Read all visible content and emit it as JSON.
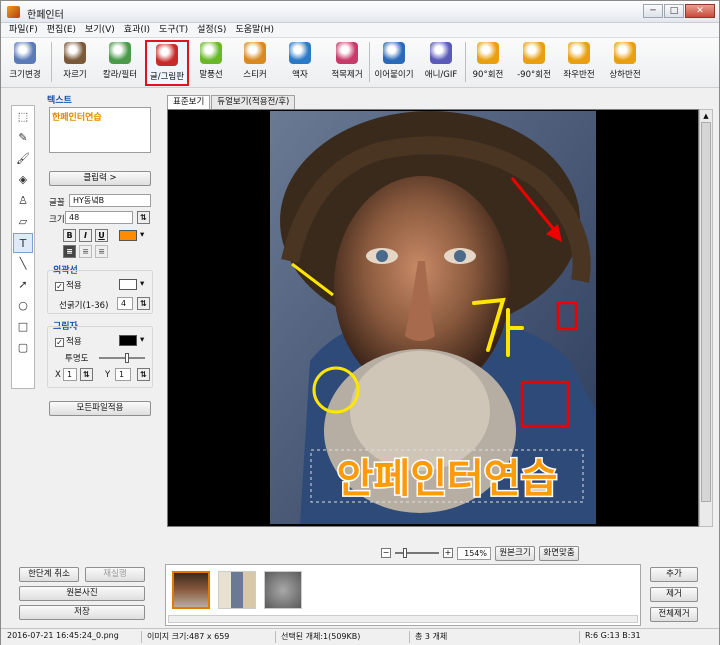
{
  "window": {
    "title": "한페인터",
    "min": "─",
    "max": "□",
    "close": "✕"
  },
  "menu": [
    "파일(F)",
    "편집(E)",
    "보기(V)",
    "효과(I)",
    "도구(T)",
    "설정(S)",
    "도움말(H)"
  ],
  "toolbar": [
    {
      "label": "크기변경",
      "icon": "resize-icon",
      "color": "#5a7ab8"
    },
    {
      "label": "자르기",
      "icon": "crop-icon",
      "color": "#7a5a3a"
    },
    {
      "label": "칼라/필터",
      "icon": "color-filter-icon",
      "color": "#4a9a4a"
    },
    {
      "label": "글/그림판",
      "icon": "text-draw-icon",
      "color": "#c82a2a",
      "selected": true
    },
    {
      "label": "말풍선",
      "icon": "speech-bubble-icon",
      "color": "#6ab82a"
    },
    {
      "label": "스티커",
      "icon": "sticker-icon",
      "color": "#d88a20"
    },
    {
      "label": "액자",
      "icon": "frame-icon",
      "color": "#2a7ac8"
    },
    {
      "label": "적목제거",
      "icon": "red-eye-icon",
      "color": "#c83a6a"
    },
    {
      "label": "이어붙이기",
      "icon": "merge-icon",
      "color": "#2a6ab8"
    },
    {
      "label": "애니/GIF",
      "icon": "gif-icon",
      "color": "#5a5ab8"
    },
    {
      "label": "90°회전",
      "icon": "rotate-cw-icon",
      "color": "#e8a010"
    },
    {
      "label": "-90°회전",
      "icon": "rotate-ccw-icon",
      "color": "#e8a010"
    },
    {
      "label": "좌우반전",
      "icon": "flip-h-icon",
      "color": "#e8a010"
    },
    {
      "label": "상하반전",
      "icon": "flip-v-icon",
      "color": "#e8a010"
    }
  ],
  "left_tools": [
    {
      "name": "select-tool-icon",
      "glyph": "⬚"
    },
    {
      "name": "pencil-tool-icon",
      "glyph": "✎"
    },
    {
      "name": "brush-tool-icon",
      "glyph": "🖌"
    },
    {
      "name": "fill-tool-icon",
      "glyph": "◈"
    },
    {
      "name": "stamp-tool-icon",
      "glyph": "♙"
    },
    {
      "name": "eraser-tool-icon",
      "glyph": "▱"
    },
    {
      "name": "text-tool-icon",
      "glyph": "T",
      "selected": true
    },
    {
      "name": "line-tool-icon",
      "glyph": "╲"
    },
    {
      "name": "arrow-tool-icon",
      "glyph": "➚"
    },
    {
      "name": "circle-tool-icon",
      "glyph": "○"
    },
    {
      "name": "rect-tool-icon",
      "glyph": "□"
    },
    {
      "name": "rounded-rect-tool-icon",
      "glyph": "▢"
    }
  ],
  "panel": {
    "text_header": "텍스트",
    "text_value": "한페인터연습",
    "clip_input_button": "클립력 >",
    "font_label": "글꼴",
    "font_value": "HY동녘B",
    "size_label": "크기",
    "size_value": "48",
    "bold": "B",
    "italic": "I",
    "underline": "U",
    "text_color": "#ff8c00",
    "outline_header": "외곽선",
    "outline_apply": "적용",
    "outline_color": "#ffffff",
    "thickness_label": "선굵기(1-36)",
    "thickness_value": "4",
    "shadow_header": "그림자",
    "shadow_apply": "적용",
    "shadow_color": "#000000",
    "opacity_label": "투명도",
    "x_label": "X",
    "x_value": "1",
    "y_label": "Y",
    "y_value": "1",
    "apply_all_button": "모든파일적용",
    "undo_button": "한단계 취소",
    "redo_button": "재실행",
    "original_button": "원본사진",
    "save_button": "저장"
  },
  "tabs": [
    "표준보기",
    "듀얼보기(적용전/후)"
  ],
  "canvas": {
    "overlay_text": "안페인터연습"
  },
  "zoom": {
    "minus": "−",
    "plus": "+",
    "value": "154%",
    "level": 0.2,
    "original_size": "원본크기",
    "fit_screen": "화면맞춤"
  },
  "thumb_actions": {
    "add": "추가",
    "remove": "제거",
    "remove_all": "전체제거"
  },
  "status": {
    "file": "2016-07-21 16:45:24_0.png",
    "image_label": "이미지 크기:487 x 659",
    "selected": "선택된 개체:1(509KB)",
    "total": "총 3 개체",
    "rgb": "R:6 G:13 B:31"
  }
}
